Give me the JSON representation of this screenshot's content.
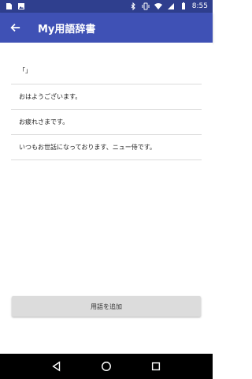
{
  "status_bar": {
    "time": "8:55",
    "left_icons": [
      "sim-card-icon",
      "image-icon"
    ],
    "right_icons": [
      "bluetooth-icon",
      "vibrate-icon",
      "wifi-icon",
      "signal-icon",
      "battery-icon"
    ]
  },
  "app_bar": {
    "title": "My用語辞書",
    "back_icon": "arrow-back-icon",
    "background_color": "#3f51b5"
  },
  "terms": [
    "「」",
    "おはようございます。",
    "お疲れさまです。",
    "いつもお世話になっております、ニュー侍です。"
  ],
  "add_button": {
    "label": "用語を追加"
  },
  "nav_bar": {
    "buttons": [
      "back-triangle-icon",
      "home-circle-icon",
      "recents-square-icon"
    ]
  }
}
